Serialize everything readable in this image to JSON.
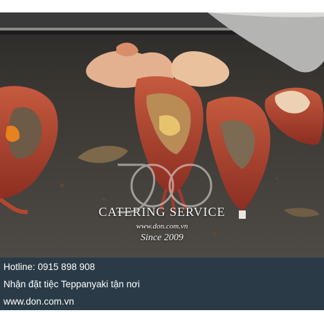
{
  "photo": {
    "subject_icon": "lobster-teppanyaki-photo",
    "watermark": {
      "brand": "CATERING SERVICE",
      "url": "www.don.com.vn",
      "since": "Since 2009"
    }
  },
  "info": {
    "hotline": "Hotline: 0915 898 908",
    "tagline": "Nhận đặt tiệc Teppanyaki tận nơi",
    "website": "www.don.com.vn"
  },
  "colors": {
    "info_background": "#2a3b47",
    "text": "#ffffff"
  }
}
